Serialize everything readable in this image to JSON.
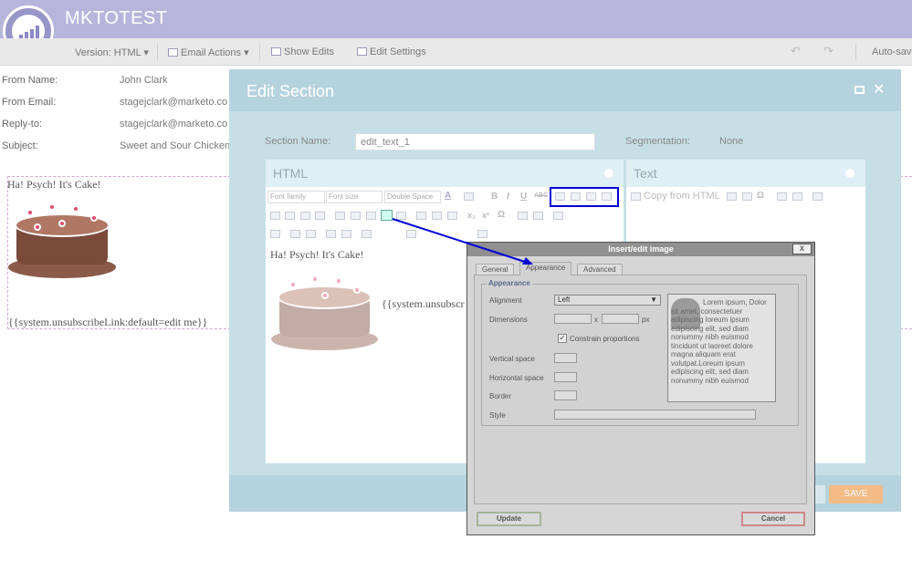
{
  "app": {
    "title": "MKTOTEST"
  },
  "toolbar": {
    "version": "Version: HTML ▾",
    "email_actions": "Email Actions ▾",
    "show_edits": "Show Edits",
    "edit_settings": "Edit Settings",
    "auto_save": "Auto-save"
  },
  "meta": [
    {
      "label": "From Name:",
      "value": "John Clark"
    },
    {
      "label": "From Email:",
      "value": "stagejclark@marketo.co"
    },
    {
      "label": "Reply-to:",
      "value": "stagejclark@marketo.co"
    },
    {
      "label": "Subject:",
      "value": "Sweet and Sour Chicken"
    }
  ],
  "email": {
    "heading": "Ha! Psych!  It's Cake!",
    "unsubscribe": "{{system.unsubscribeLink:default=edit me}}"
  },
  "modal": {
    "title": "Edit Section",
    "section_name_label": "Section Name:",
    "section_name_value": "edit_text_1",
    "segmentation_label": "Segmentation:",
    "segmentation_value": "None",
    "html_panel_title": "HTML",
    "text_panel_title": "Text",
    "copy_from_html": "Copy from HTML",
    "font_family": "Font family",
    "font_size": "Font size",
    "spacing": "Double Space",
    "editor_heading": "Ha! Psych!  It's Cake!",
    "editor_unsubscribe": "{{system.unsubscr",
    "save_label": "SAVE"
  },
  "dialog": {
    "title": "Insert/edit image",
    "close": "x",
    "tabs": [
      "General",
      "Appearance",
      "Advanced"
    ],
    "legend": "Appearance",
    "alignment_label": "Alignment",
    "alignment_value": "Left",
    "dimensions_label": "Dimensions",
    "x_sep": "x",
    "px_unit": "px",
    "constrain_label": "Constrain proportions",
    "vertical_space_label": "Vertical space",
    "horizontal_space_label": "Horizontal space",
    "border_label": "Border",
    "style_label": "Style",
    "preview_text": "Lorem ipsum, Dolor sit amet, consectetuer adipiscing loreum ipsum edipiscing elit, sed diam nonummy nibh euismod tincidunt ut laoreet dolore magna aliquam erat volutpat.Loreum ipsum edipiscing elit, sed diam nonummy nibh euismod",
    "update_label": "Update",
    "cancel_label": "Cancel"
  },
  "colors": {
    "header": "#b6b6dc",
    "modal": "#c6dfe7",
    "save": "#f3bb86",
    "highlight": "#0000d6"
  }
}
